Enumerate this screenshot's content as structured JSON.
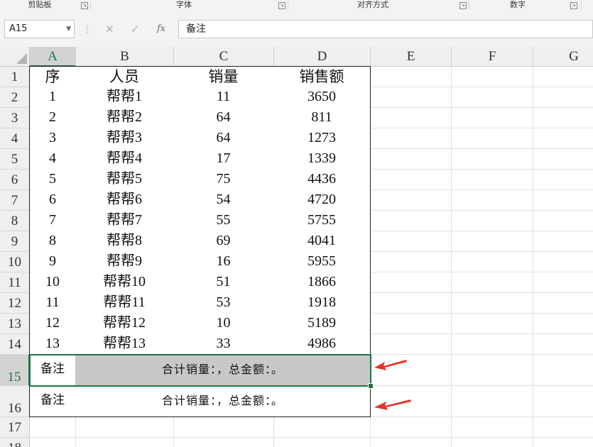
{
  "ribbon": {
    "groups": [
      "剪贴板",
      "字体",
      "对齐方式",
      "数字"
    ]
  },
  "formula_bar": {
    "name_box": "A15",
    "cancel_glyph": "✕",
    "enter_glyph": "✓",
    "fx_label": "fx",
    "formula": "备注"
  },
  "columns": [
    "A",
    "B",
    "C",
    "D",
    "E",
    "F",
    "G"
  ],
  "row_numbers": [
    "1",
    "2",
    "3",
    "4",
    "5",
    "6",
    "7",
    "8",
    "9",
    "10",
    "11",
    "12",
    "13",
    "14",
    "15",
    "16",
    "17",
    "18"
  ],
  "table": {
    "headers": [
      "序",
      "人员",
      "销量",
      "销售额"
    ],
    "rows": [
      [
        "1",
        "帮帮1",
        "11",
        "3650"
      ],
      [
        "2",
        "帮帮2",
        "64",
        "811"
      ],
      [
        "3",
        "帮帮3",
        "64",
        "1273"
      ],
      [
        "4",
        "帮帮4",
        "17",
        "1339"
      ],
      [
        "5",
        "帮帮5",
        "75",
        "4436"
      ],
      [
        "6",
        "帮帮6",
        "54",
        "4720"
      ],
      [
        "7",
        "帮帮7",
        "55",
        "5755"
      ],
      [
        "8",
        "帮帮8",
        "69",
        "4041"
      ],
      [
        "9",
        "帮帮9",
        "16",
        "5955"
      ],
      [
        "10",
        "帮帮10",
        "51",
        "1866"
      ],
      [
        "11",
        "帮帮11",
        "53",
        "1918"
      ],
      [
        "12",
        "帮帮12",
        "10",
        "5189"
      ],
      [
        "13",
        "帮帮13",
        "33",
        "4986"
      ]
    ],
    "note_rows": [
      {
        "label": "备注",
        "text": "合计销量：，总金额：。"
      },
      {
        "label": "备注",
        "text": "合计销量：，总金额：。"
      }
    ]
  },
  "selected_cell": "A15",
  "colors": {
    "excel_green": "#217346",
    "arrow_red": "#e8312c",
    "header_bg": "#efefef",
    "shaded_cell": "#c8c8c8"
  }
}
